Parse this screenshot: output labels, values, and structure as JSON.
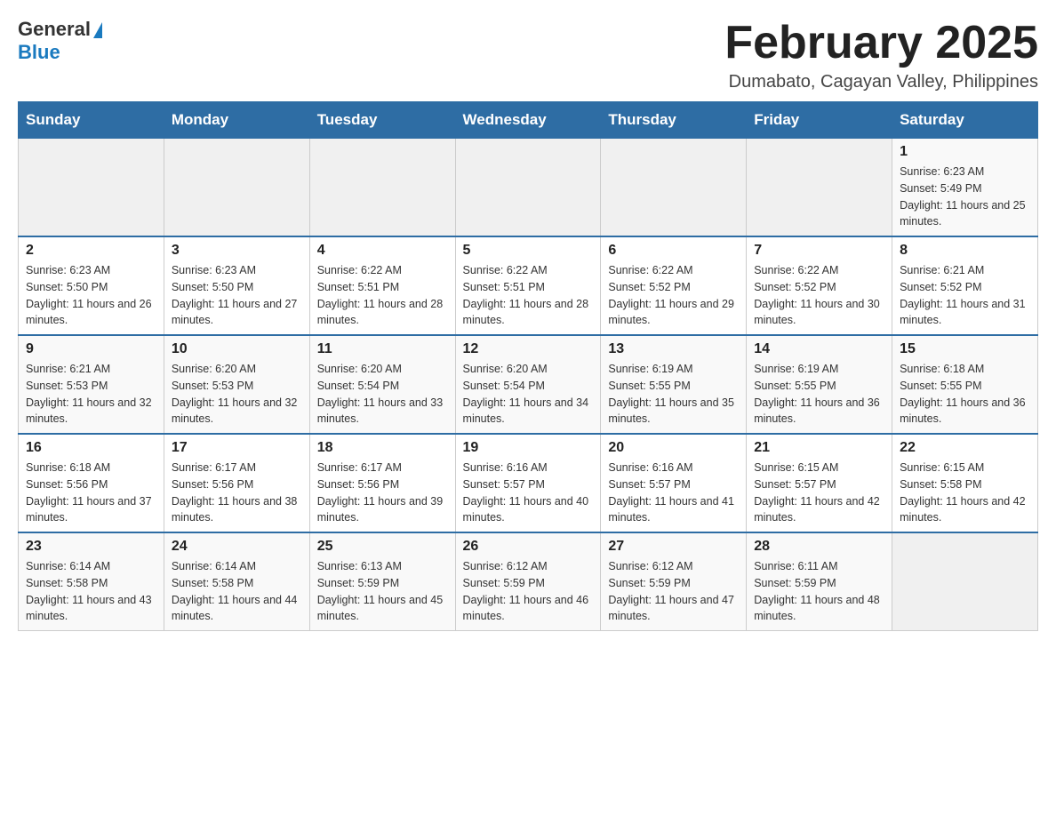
{
  "header": {
    "logo_general": "General",
    "logo_blue": "Blue",
    "calendar_title": "February 2025",
    "location": "Dumabato, Cagayan Valley, Philippines"
  },
  "days_of_week": [
    "Sunday",
    "Monday",
    "Tuesday",
    "Wednesday",
    "Thursday",
    "Friday",
    "Saturday"
  ],
  "weeks": [
    [
      {
        "day": "",
        "sunrise": "",
        "sunset": "",
        "daylight": ""
      },
      {
        "day": "",
        "sunrise": "",
        "sunset": "",
        "daylight": ""
      },
      {
        "day": "",
        "sunrise": "",
        "sunset": "",
        "daylight": ""
      },
      {
        "day": "",
        "sunrise": "",
        "sunset": "",
        "daylight": ""
      },
      {
        "day": "",
        "sunrise": "",
        "sunset": "",
        "daylight": ""
      },
      {
        "day": "",
        "sunrise": "",
        "sunset": "",
        "daylight": ""
      },
      {
        "day": "1",
        "sunrise": "Sunrise: 6:23 AM",
        "sunset": "Sunset: 5:49 PM",
        "daylight": "Daylight: 11 hours and 25 minutes."
      }
    ],
    [
      {
        "day": "2",
        "sunrise": "Sunrise: 6:23 AM",
        "sunset": "Sunset: 5:50 PM",
        "daylight": "Daylight: 11 hours and 26 minutes."
      },
      {
        "day": "3",
        "sunrise": "Sunrise: 6:23 AM",
        "sunset": "Sunset: 5:50 PM",
        "daylight": "Daylight: 11 hours and 27 minutes."
      },
      {
        "day": "4",
        "sunrise": "Sunrise: 6:22 AM",
        "sunset": "Sunset: 5:51 PM",
        "daylight": "Daylight: 11 hours and 28 minutes."
      },
      {
        "day": "5",
        "sunrise": "Sunrise: 6:22 AM",
        "sunset": "Sunset: 5:51 PM",
        "daylight": "Daylight: 11 hours and 28 minutes."
      },
      {
        "day": "6",
        "sunrise": "Sunrise: 6:22 AM",
        "sunset": "Sunset: 5:52 PM",
        "daylight": "Daylight: 11 hours and 29 minutes."
      },
      {
        "day": "7",
        "sunrise": "Sunrise: 6:22 AM",
        "sunset": "Sunset: 5:52 PM",
        "daylight": "Daylight: 11 hours and 30 minutes."
      },
      {
        "day": "8",
        "sunrise": "Sunrise: 6:21 AM",
        "sunset": "Sunset: 5:52 PM",
        "daylight": "Daylight: 11 hours and 31 minutes."
      }
    ],
    [
      {
        "day": "9",
        "sunrise": "Sunrise: 6:21 AM",
        "sunset": "Sunset: 5:53 PM",
        "daylight": "Daylight: 11 hours and 32 minutes."
      },
      {
        "day": "10",
        "sunrise": "Sunrise: 6:20 AM",
        "sunset": "Sunset: 5:53 PM",
        "daylight": "Daylight: 11 hours and 32 minutes."
      },
      {
        "day": "11",
        "sunrise": "Sunrise: 6:20 AM",
        "sunset": "Sunset: 5:54 PM",
        "daylight": "Daylight: 11 hours and 33 minutes."
      },
      {
        "day": "12",
        "sunrise": "Sunrise: 6:20 AM",
        "sunset": "Sunset: 5:54 PM",
        "daylight": "Daylight: 11 hours and 34 minutes."
      },
      {
        "day": "13",
        "sunrise": "Sunrise: 6:19 AM",
        "sunset": "Sunset: 5:55 PM",
        "daylight": "Daylight: 11 hours and 35 minutes."
      },
      {
        "day": "14",
        "sunrise": "Sunrise: 6:19 AM",
        "sunset": "Sunset: 5:55 PM",
        "daylight": "Daylight: 11 hours and 36 minutes."
      },
      {
        "day": "15",
        "sunrise": "Sunrise: 6:18 AM",
        "sunset": "Sunset: 5:55 PM",
        "daylight": "Daylight: 11 hours and 36 minutes."
      }
    ],
    [
      {
        "day": "16",
        "sunrise": "Sunrise: 6:18 AM",
        "sunset": "Sunset: 5:56 PM",
        "daylight": "Daylight: 11 hours and 37 minutes."
      },
      {
        "day": "17",
        "sunrise": "Sunrise: 6:17 AM",
        "sunset": "Sunset: 5:56 PM",
        "daylight": "Daylight: 11 hours and 38 minutes."
      },
      {
        "day": "18",
        "sunrise": "Sunrise: 6:17 AM",
        "sunset": "Sunset: 5:56 PM",
        "daylight": "Daylight: 11 hours and 39 minutes."
      },
      {
        "day": "19",
        "sunrise": "Sunrise: 6:16 AM",
        "sunset": "Sunset: 5:57 PM",
        "daylight": "Daylight: 11 hours and 40 minutes."
      },
      {
        "day": "20",
        "sunrise": "Sunrise: 6:16 AM",
        "sunset": "Sunset: 5:57 PM",
        "daylight": "Daylight: 11 hours and 41 minutes."
      },
      {
        "day": "21",
        "sunrise": "Sunrise: 6:15 AM",
        "sunset": "Sunset: 5:57 PM",
        "daylight": "Daylight: 11 hours and 42 minutes."
      },
      {
        "day": "22",
        "sunrise": "Sunrise: 6:15 AM",
        "sunset": "Sunset: 5:58 PM",
        "daylight": "Daylight: 11 hours and 42 minutes."
      }
    ],
    [
      {
        "day": "23",
        "sunrise": "Sunrise: 6:14 AM",
        "sunset": "Sunset: 5:58 PM",
        "daylight": "Daylight: 11 hours and 43 minutes."
      },
      {
        "day": "24",
        "sunrise": "Sunrise: 6:14 AM",
        "sunset": "Sunset: 5:58 PM",
        "daylight": "Daylight: 11 hours and 44 minutes."
      },
      {
        "day": "25",
        "sunrise": "Sunrise: 6:13 AM",
        "sunset": "Sunset: 5:59 PM",
        "daylight": "Daylight: 11 hours and 45 minutes."
      },
      {
        "day": "26",
        "sunrise": "Sunrise: 6:12 AM",
        "sunset": "Sunset: 5:59 PM",
        "daylight": "Daylight: 11 hours and 46 minutes."
      },
      {
        "day": "27",
        "sunrise": "Sunrise: 6:12 AM",
        "sunset": "Sunset: 5:59 PM",
        "daylight": "Daylight: 11 hours and 47 minutes."
      },
      {
        "day": "28",
        "sunrise": "Sunrise: 6:11 AM",
        "sunset": "Sunset: 5:59 PM",
        "daylight": "Daylight: 11 hours and 48 minutes."
      },
      {
        "day": "",
        "sunrise": "",
        "sunset": "",
        "daylight": ""
      }
    ]
  ]
}
